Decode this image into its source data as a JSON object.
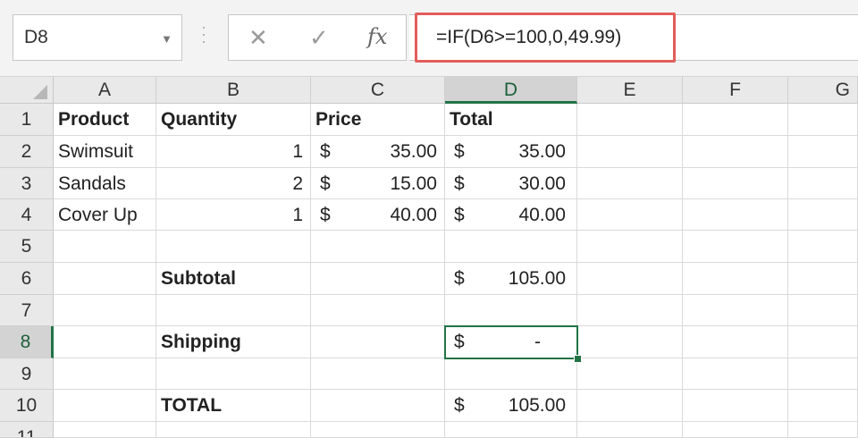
{
  "name_box": {
    "value": "D8"
  },
  "formula_bar": {
    "formula": "=IF(D6>=100,0,49.99)"
  },
  "columns": [
    "A",
    "B",
    "C",
    "D",
    "E",
    "F",
    "G"
  ],
  "rows": [
    "1",
    "2",
    "3",
    "4",
    "5",
    "6",
    "7",
    "8",
    "9",
    "10",
    "11"
  ],
  "selected": {
    "column": "D",
    "row": "8"
  },
  "cells": {
    "A1": "Product",
    "B1": "Quantity",
    "C1": "Price",
    "D1": "Total",
    "A2": "Swimsuit",
    "B2": "1",
    "C2_cur": "$",
    "C2": "35.00",
    "D2_cur": "$",
    "D2": "35.00",
    "A3": "Sandals",
    "B3": "2",
    "C3_cur": "$",
    "C3": "15.00",
    "D3_cur": "$",
    "D3": "30.00",
    "A4": "Cover Up",
    "B4": "1",
    "C4_cur": "$",
    "C4": "40.00",
    "D4_cur": "$",
    "D4": "40.00",
    "B6": "Subtotal",
    "D6_cur": "$",
    "D6": "105.00",
    "B8": "Shipping",
    "D8_cur": "$",
    "D8": "-",
    "B10": "TOTAL",
    "D10_cur": "$",
    "D10": "105.00"
  },
  "colors": {
    "selection": "#217346",
    "formula_highlight": "#e35d5b"
  }
}
